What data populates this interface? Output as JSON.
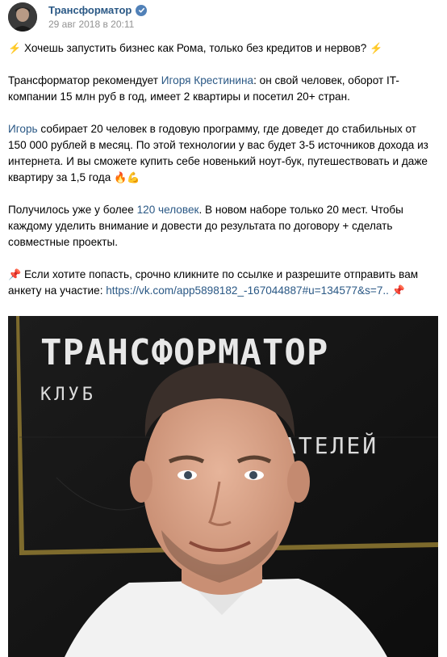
{
  "post": {
    "author": "Трансформатор",
    "date": "29 авг 2018 в 20:11",
    "para1": {
      "text": "Хочешь запустить бизнес как Рома, только без кредитов и нервов?",
      "icon": "lightning-icon"
    },
    "para2": {
      "before": "Трансформатор рекомендует ",
      "link": "Игоря Крестинина",
      "after": ": он свой человек, оборот IT-компании 15 млн руб в год, имеет 2 квартиры и посетил 20+ стран."
    },
    "para3": {
      "link": "Игорь",
      "after": " собирает 20 человек в годовую программу, где доведет до стабильных от 150 000 рублей в месяц. По этой технологии у вас будет 3-5 источников дохода из интернета. И вы сможете купить себе новенький ноут-бук, путешествовать и даже квартиру за 1,5 года"
    },
    "para4": {
      "before": "Получилось уже у более ",
      "link": "120 человек",
      "after": ". В новом наборе только 20 мест. Чтобы каждому уделить внимание и довести до результата по договору + сделать совместные проекты."
    },
    "para5": {
      "before": "Если хотите попасть, срочно кликните по ссылке и разрешите отправить вам анкету на участие: ",
      "link": "https://vk.com/app5898182_-167044887#u=134577&s=7.."
    },
    "photo": {
      "sign_line1": "ТРАНСФОРМАТОР",
      "sign_line2_left": "КЛУБ",
      "sign_line2_right": "АТЕЛЕЙ"
    }
  },
  "colors": {
    "link": "#2a5885",
    "date": "#939393",
    "verified": "#5181b8"
  }
}
